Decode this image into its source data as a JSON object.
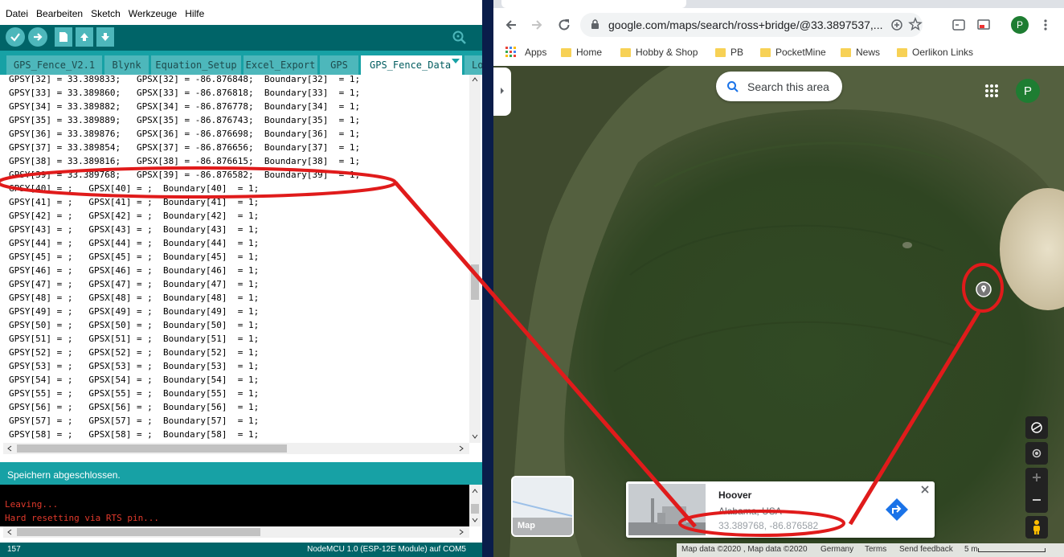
{
  "arduino": {
    "menu": [
      "Datei",
      "Bearbeiten",
      "Sketch",
      "Werkzeuge",
      "Hilfe"
    ],
    "tabs": [
      "GPS_Fence_V2.1",
      "Blynk",
      "Equation_Setup",
      "Excel_Export",
      "GPS",
      "GPS_Fence_Data",
      "Lo"
    ],
    "code_lines": [
      "GPSY[32] = 33.389833;   GPSX[32] = -86.876848;  Boundary[32]  = 1;",
      "GPSY[33] = 33.389860;   GPSX[33] = -86.876818;  Boundary[33]  = 1;",
      "GPSY[34] = 33.389882;   GPSX[34] = -86.876778;  Boundary[34]  = 1;",
      "GPSY[35] = 33.389889;   GPSX[35] = -86.876743;  Boundary[35]  = 1;",
      "GPSY[36] = 33.389876;   GPSX[36] = -86.876698;  Boundary[36]  = 1;",
      "GPSY[37] = 33.389854;   GPSX[37] = -86.876656;  Boundary[37]  = 1;",
      "GPSY[38] = 33.389816;   GPSX[38] = -86.876615;  Boundary[38]  = 1;",
      "GPSY[39] = 33.389768;   GPSX[39] = -86.876582;  Boundary[39]  = 1;",
      "GPSY[40] = ;   GPSX[40] = ;  Boundary[40]  = 1;",
      "GPSY[41] = ;   GPSX[41] = ;  Boundary[41]  = 1;",
      "GPSY[42] = ;   GPSX[42] = ;  Boundary[42]  = 1;",
      "GPSY[43] = ;   GPSX[43] = ;  Boundary[43]  = 1;",
      "GPSY[44] = ;   GPSX[44] = ;  Boundary[44]  = 1;",
      "GPSY[45] = ;   GPSX[45] = ;  Boundary[45]  = 1;",
      "GPSY[46] = ;   GPSX[46] = ;  Boundary[46]  = 1;",
      "GPSY[47] = ;   GPSX[47] = ;  Boundary[47]  = 1;",
      "GPSY[48] = ;   GPSX[48] = ;  Boundary[48]  = 1;",
      "GPSY[49] = ;   GPSX[49] = ;  Boundary[49]  = 1;",
      "GPSY[50] = ;   GPSX[50] = ;  Boundary[50]  = 1;",
      "GPSY[51] = ;   GPSX[51] = ;  Boundary[51]  = 1;",
      "GPSY[52] = ;   GPSX[52] = ;  Boundary[52]  = 1;",
      "GPSY[53] = ;   GPSX[53] = ;  Boundary[53]  = 1;",
      "GPSY[54] = ;   GPSX[54] = ;  Boundary[54]  = 1;",
      "GPSY[55] = ;   GPSX[55] = ;  Boundary[55]  = 1;",
      "GPSY[56] = ;   GPSX[56] = ;  Boundary[56]  = 1;",
      "GPSY[57] = ;   GPSX[57] = ;  Boundary[57]  = 1;",
      "GPSY[58] = ;   GPSX[58] = ;  Boundary[58]  = 1;"
    ],
    "status_text": "Speichern abgeschlossen.",
    "console_lines": [
      "Leaving...",
      "Hard resetting via RTS pin..."
    ],
    "line_number": "157",
    "board": "NodeMCU 1.0 (ESP-12E Module) auf COM5",
    "colors": {
      "toolbar": "#006468",
      "tabs": "#17a1a5",
      "console_text": "#e23a2c"
    }
  },
  "browser": {
    "url": "google.com/maps/search/ross+bridge/@33.3897537,...",
    "profile_initial": "P",
    "bookmarks": [
      "Apps",
      "Home",
      "Hobby & Shop",
      "PB",
      "PocketMine",
      "News",
      "Oerlikon Links"
    ]
  },
  "map": {
    "search_area_label": "Search this area",
    "profile_initial": "P",
    "layer_label": "Map",
    "place_name": "Hoover",
    "place_region": "Alabama, USA",
    "coordinates": "33.389768, -86.876582",
    "attribution": "Map data ©2020 , Map data ©2020",
    "footer_links": [
      "Germany",
      "Terms",
      "Send feedback"
    ],
    "scale": "5 m"
  },
  "annotation": {
    "color": "#e01b1b"
  }
}
